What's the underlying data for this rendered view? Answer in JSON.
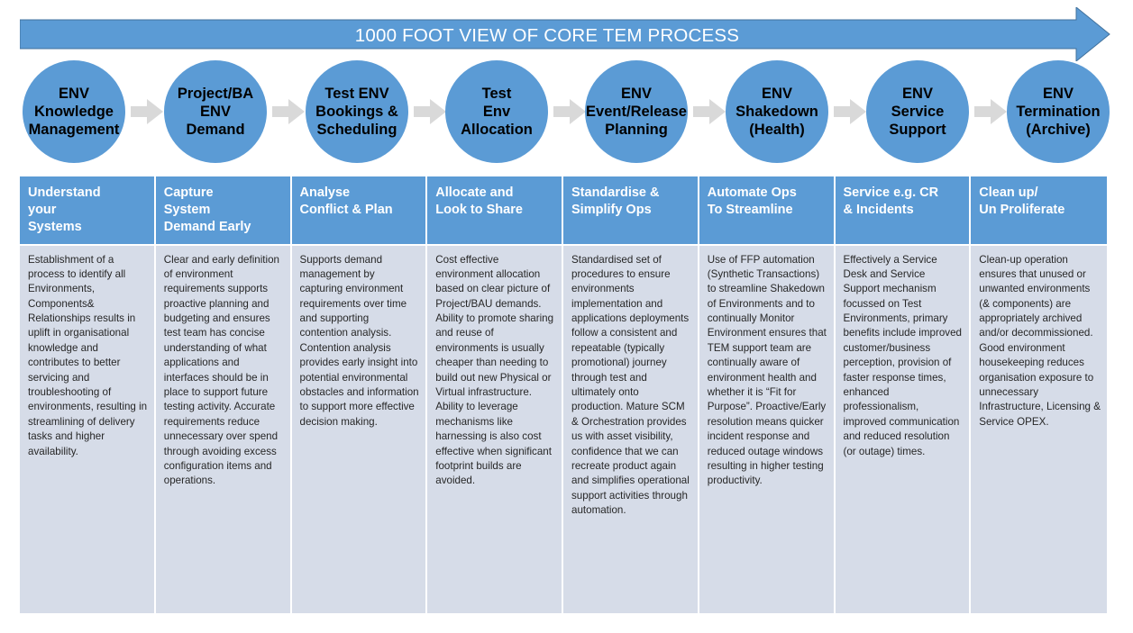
{
  "banner": {
    "title": "1000 FOOT VIEW OF CORE TEM PROCESS",
    "fill_color": "#5B9BD5",
    "text_color": "#FFFFFF"
  },
  "colors": {
    "accent_blue": "#5B9BD5",
    "body_cell": "#D6DCE8",
    "chevron_gray": "#D9D9D9",
    "body_text": "#262626"
  },
  "process_steps": [
    {
      "label": "ENV\nKnowledge\nManagement"
    },
    {
      "label": "Project/BA\nENV\nDemand"
    },
    {
      "label": "Test ENV\nBookings &\nScheduling"
    },
    {
      "label": "Test\nEnv\nAllocation"
    },
    {
      "label": "ENV\nEvent/Release\nPlanning"
    },
    {
      "label": "ENV\nShakedown\n(Health)"
    },
    {
      "label": "ENV\nService\nSupport"
    },
    {
      "label": "ENV\nTermination\n(Archive)"
    }
  ],
  "connectors": [
    {
      "name": "chevron-arrow-1"
    },
    {
      "name": "chevron-arrow-2"
    },
    {
      "name": "chevron-arrow-3"
    },
    {
      "name": "chevron-arrow-4"
    },
    {
      "name": "chevron-arrow-5"
    },
    {
      "name": "chevron-arrow-6"
    },
    {
      "name": "chevron-arrow-7"
    }
  ],
  "table": {
    "headers": [
      "Understand\nyour\nSystems",
      "Capture\nSystem\nDemand Early",
      "Analyse\nConflict & Plan",
      "Allocate and\nLook to Share",
      "Standardise &\nSimplify Ops",
      "Automate Ops\nTo Streamline",
      "Service e.g. CR\n& Incidents",
      "Clean up/\nUn Proliferate"
    ],
    "cells": [
      "Establishment of a process to identify all Environments, Components& Relationships results in uplift in organisational knowledge and contributes to better servicing and troubleshooting of environments, resulting in streamlining of delivery tasks and higher availability.",
      "Clear and early definition of environment requirements supports proactive planning and budgeting and ensures test team has concise understanding of what applications and interfaces should be in place to support future testing activity. Accurate requirements reduce unnecessary over spend through avoiding excess configuration items and operations.",
      "Supports demand management by capturing environment requirements over time and supporting contention analysis. Contention analysis provides early insight into potential environmental obstacles and information to support more effective decision making.",
      "Cost effective environment allocation based on clear picture of Project/BAU demands. Ability to promote sharing and reuse of environments is usually cheaper than needing to build out new Physical or Virtual infrastructure. Ability to leverage mechanisms like harnessing is also cost effective when significant footprint builds are avoided.",
      "Standardised set of procedures to ensure environments implementation and applications deployments follow a consistent and repeatable (typically promotional) journey through test and ultimately onto production. Mature SCM & Orchestration provides us with asset visibility, confidence that we can recreate product again and simplifies operational support activities through automation.",
      "Use of FFP automation (Synthetic Transactions) to streamline Shakedown of Environments and to continually Monitor Environment ensures that TEM support team are continually aware of environment health and whether it is “Fit for Purpose”. Proactive/Early resolution means quicker incident response and reduced outage windows resulting in higher testing productivity.",
      "Effectively a Service Desk and Service Support mechanism focussed on Test Environments, primary benefits include improved customer/business perception, provision of faster response times, enhanced professionalism, improved communication and reduced resolution (or outage) times.",
      "Clean-up operation ensures that unused or unwanted environments (& components) are appropriately archived and/or decommissioned. Good environment housekeeping reduces organisation exposure to unnecessary Infrastructure, Licensing & Service OPEX."
    ]
  }
}
